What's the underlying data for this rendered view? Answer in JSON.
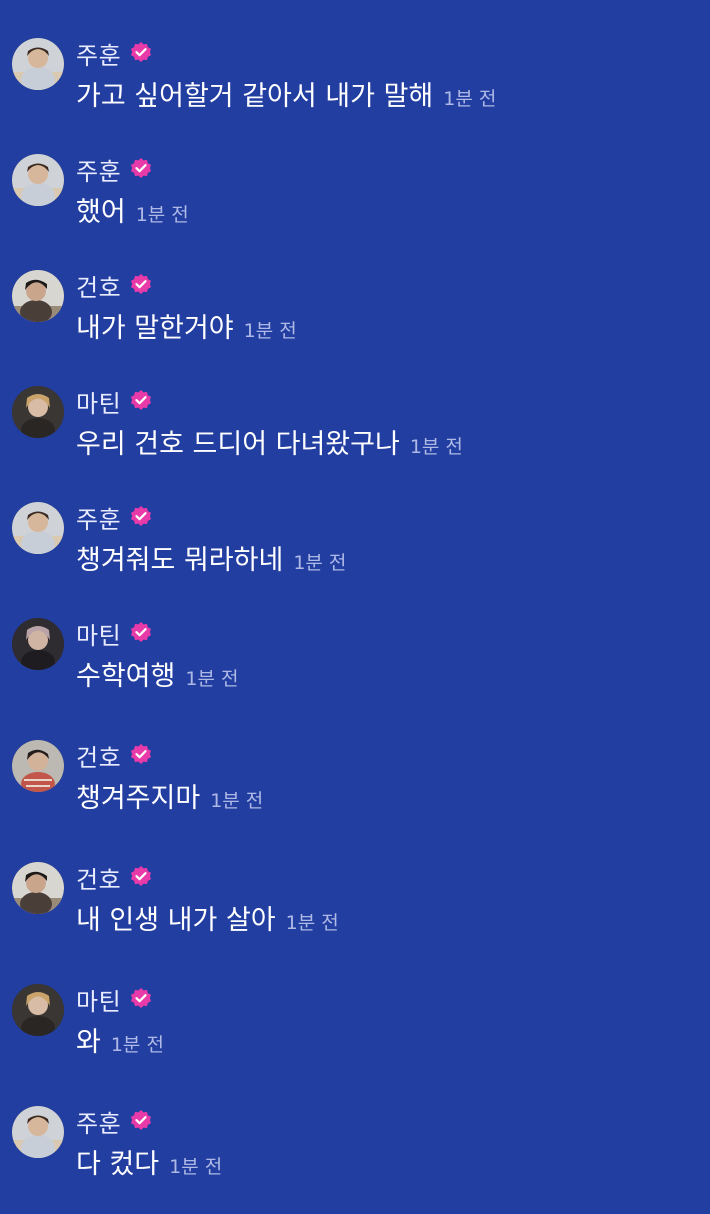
{
  "messages": [
    {
      "user": "주훈",
      "text": "가고 싶어할거 같아서 내가 말해",
      "time": "1분 전"
    },
    {
      "user": "주훈",
      "text": "했어",
      "time": "1분 전"
    },
    {
      "user": "건호",
      "text": "내가 말한거야",
      "time": "1분 전"
    },
    {
      "user": "마틴",
      "text": "우리 건호 드디어 다녀왔구나",
      "time": "1분 전"
    },
    {
      "user": "주훈",
      "text": "챙겨줘도 뭐라하네",
      "time": "1분 전"
    },
    {
      "user": "마틴",
      "text": "수학여행",
      "time": "1분 전"
    },
    {
      "user": "건호",
      "text": "챙겨주지마",
      "time": "1분 전"
    },
    {
      "user": "건호",
      "text": "내 인생 내가 살아",
      "time": "1분 전"
    },
    {
      "user": "마틴",
      "text": "와",
      "time": "1분 전"
    },
    {
      "user": "주훈",
      "text": "다 컸다",
      "time": "1분 전"
    }
  ],
  "colors": {
    "background": "#233ea1",
    "verified_badge": "#e83aa8",
    "timestamp": "#aeb9e6"
  },
  "icons": {
    "verified": "verified-badge-icon",
    "avatar": "user-avatar"
  }
}
